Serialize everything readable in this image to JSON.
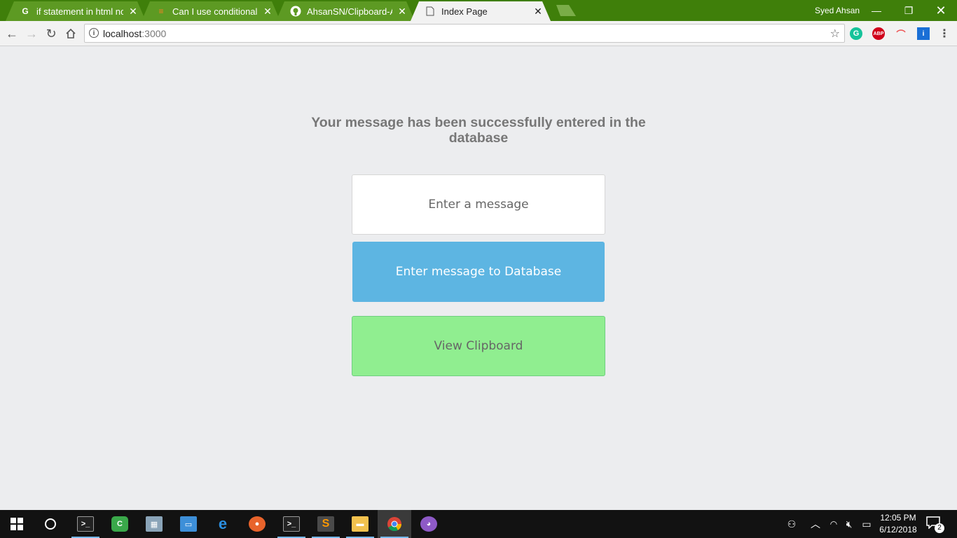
{
  "browser": {
    "tabs": [
      {
        "title": "if statement in html node",
        "icon": "google-icon"
      },
      {
        "title": "Can I use conditional stat",
        "icon": "stackoverflow-icon"
      },
      {
        "title": "AhsanSN/Clipboard-App",
        "icon": "github-icon"
      },
      {
        "title": "Index Page",
        "icon": "page-icon"
      }
    ],
    "user_name": "Syed Ahsan",
    "url_host": "localhost",
    "url_port": ":3000"
  },
  "page": {
    "message": "Your message has been successfully entered in the database",
    "input_placeholder": "Enter a message",
    "enter_button": "Enter message to Database",
    "view_button": "View Clipboard"
  },
  "taskbar": {
    "time": "12:05 PM",
    "date": "6/12/2018",
    "notification_count": "2"
  },
  "colors": {
    "titlebar": "#3f7f0a",
    "enter_button": "#5db5e2",
    "view_button": "#90ee90",
    "page_bg": "#ecedef"
  }
}
